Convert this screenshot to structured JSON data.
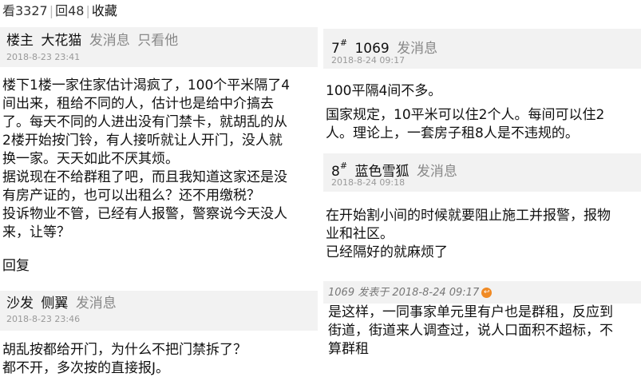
{
  "stats": {
    "views": "看3327",
    "replies": "回48",
    "favorite": "收藏"
  },
  "left": {
    "post1": {
      "floor": "楼主",
      "user": "大花猫",
      "send_msg": "发消息",
      "only_view": "只看他",
      "date": "2018-8-23 23:41",
      "lines": [
        "楼下1楼一家住家估计渴疯了，100个平米隔了4",
        "间出来，租给不同的人，估计也是给中介搞去",
        "了。每天不同的人进出没有门禁卡，就胡乱的从",
        "2楼开始按门铃，有人接听就让人开门，没人就",
        "换一家。天天如此不厌其烦。",
        "据说现在不给群租了吧，而且我知道这家还是没",
        "有房产证的，也可以出租么？还不用缴税？",
        "投诉物业不管，已经有人报警，警察说今天没人",
        "来，让等？"
      ],
      "reply_label": "回复"
    },
    "post2": {
      "floor": "沙发",
      "user": "侧翼",
      "send_msg": "发消息",
      "date": "2018-8-23 23:46",
      "lines": [
        "胡乱按都给开门，为什么不把门禁拆了？",
        "都不开，多次按的直接报J。"
      ]
    }
  },
  "right": {
    "post7": {
      "floor": "7",
      "floor_mark": "#",
      "user": "1069",
      "send_msg": "发消息",
      "date": "2018-8-24 09:17",
      "line1": "100平隔4间不多。",
      "lines2": [
        "国家规定，10平米可以住2个人。每间可以住2",
        "人。理论上，一套房子租8人是不违规的。"
      ]
    },
    "post8": {
      "floor": "8",
      "floor_mark": "#",
      "user": "蓝色雪狐",
      "send_msg": "发消息",
      "date": "2018-8-24 09:18",
      "lines": [
        "在开始割小间的时候就要阻止施工并报警，报物",
        "业和社区。",
        "已经隔好的就麻烦了"
      ]
    },
    "post9": {
      "quote_meta": "1069 发表于 2018-8-24 09:17",
      "lines": [
        "是这样，一同事家单元里有户也是群租，反应到",
        "街道，街道来人调查过，说人口面积不超标，不",
        "算群租"
      ]
    }
  },
  "colors": {
    "header_bg": "#f2f2f2",
    "muted": "#888888",
    "date": "#999999",
    "reply_icon": "#f08a24"
  }
}
